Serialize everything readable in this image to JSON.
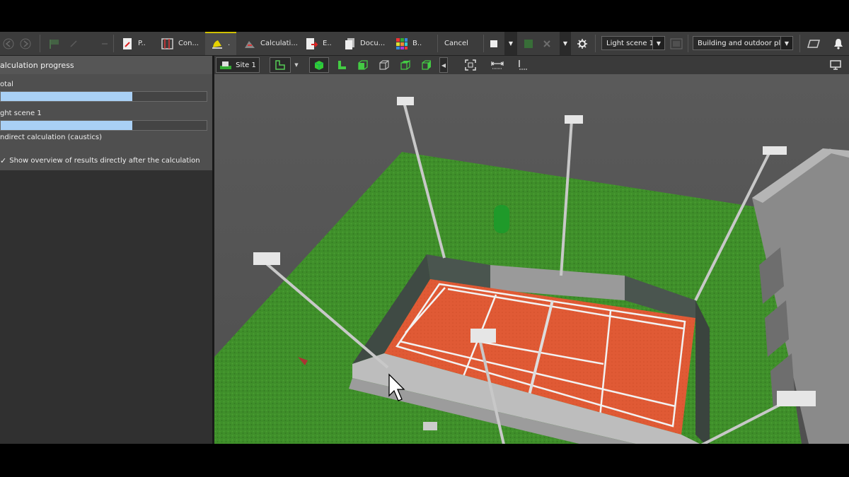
{
  "toolbar": {
    "tabs": [
      {
        "label": "P..",
        "icon": "report-icon"
      },
      {
        "label": "Con...",
        "icon": "construction-icon"
      },
      {
        "label": ".",
        "icon": "light-icon"
      },
      {
        "label": "Calculati...",
        "icon": "calculation-icon"
      },
      {
        "label": "E..",
        "icon": "export-icon"
      },
      {
        "label": "Docu...",
        "icon": "documents-icon"
      },
      {
        "label": "B..",
        "icon": "bim-icon"
      }
    ],
    "cancel_label": "Cancel",
    "light_scene_select": "Light scene 1",
    "building_select": "Building and outdoor pla..."
  },
  "panel": {
    "title": "alculation progress",
    "total_label": "otal",
    "total_progress": 0.64,
    "scene_label": "ght scene 1",
    "scene_progress": 0.64,
    "step_label": "ndirect calculation (caustics)",
    "checkbox_label": "Show overview of results directly after the calculation",
    "checkbox_checked": true
  },
  "viewport": {
    "site_label": "Site 1"
  },
  "colors": {
    "progress_fill": "#a9d0f5",
    "court_clay": "#e05a35",
    "grass": "#3f8f2a",
    "active_tab_accent": "#d0c000"
  }
}
